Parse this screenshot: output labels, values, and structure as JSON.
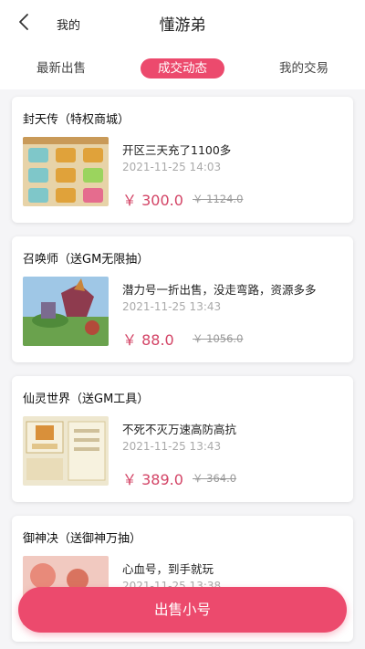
{
  "header": {
    "back_icon": "chevron-left-icon",
    "mine_label": "我的",
    "title": "懂游弟"
  },
  "tabs": [
    {
      "label": "最新出售",
      "active": false
    },
    {
      "label": "成交动态",
      "active": true
    },
    {
      "label": "我的交易",
      "active": false
    }
  ],
  "colors": {
    "accent": "#ec4a6d",
    "price": "#d34466"
  },
  "items": [
    {
      "title": "封天传（特权商城）",
      "desc": "开区三天充了1100多",
      "time": "2021-11-25 14:03",
      "price": "￥ 300.0",
      "original_price": "￥ 1124.0"
    },
    {
      "title": "召唤师（送GM无限抽）",
      "desc": "潜力号一折出售，没走弯路，资源多多",
      "time": "2021-11-25 13:43",
      "price": "￥ 88.0",
      "original_price": "￥ 1056.0"
    },
    {
      "title": "仙灵世界（送GM工具）",
      "desc": "不死不灭万速高防高抗",
      "time": "2021-11-25 13:43",
      "price": "￥ 389.0",
      "original_price": "￥ 364.0"
    },
    {
      "title": "御神决（送御神万抽）",
      "desc": "心血号，到手就玩",
      "time": "2021-11-25 13:38",
      "price": "",
      "original_price": ""
    }
  ],
  "sell_button": {
    "label": "出售小号"
  }
}
